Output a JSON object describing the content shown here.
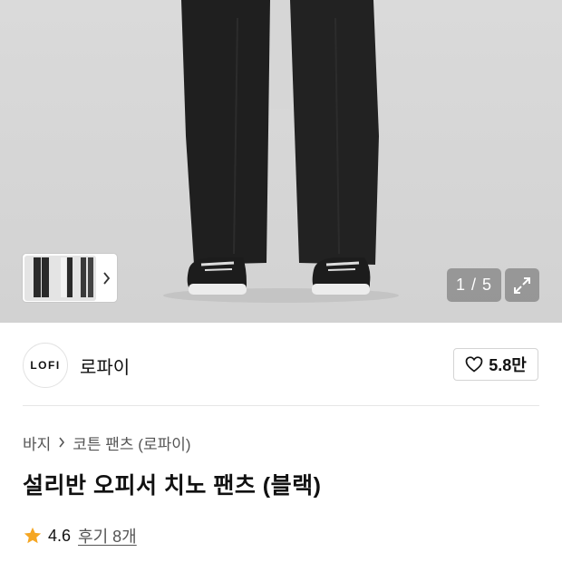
{
  "gallery": {
    "counter": "1 / 5",
    "expand_icon": "expand-icon",
    "thumb_chevron_icon": "chevron-right-icon"
  },
  "brand": {
    "logo_text": "LOFI",
    "name": "로파이",
    "like_count": "5.8만",
    "like_icon": "heart-outline-icon"
  },
  "breadcrumb": {
    "items": [
      "바지",
      "코튼 팬츠 (로파이)"
    ],
    "separator_icon": "chevron-right-icon"
  },
  "product": {
    "title": "설리반 오피서 치노 팬츠 (블랙)"
  },
  "rating": {
    "star_icon": "star-icon",
    "star_color": "#f5a623",
    "value": "4.6",
    "review_link": "후기 8개"
  }
}
